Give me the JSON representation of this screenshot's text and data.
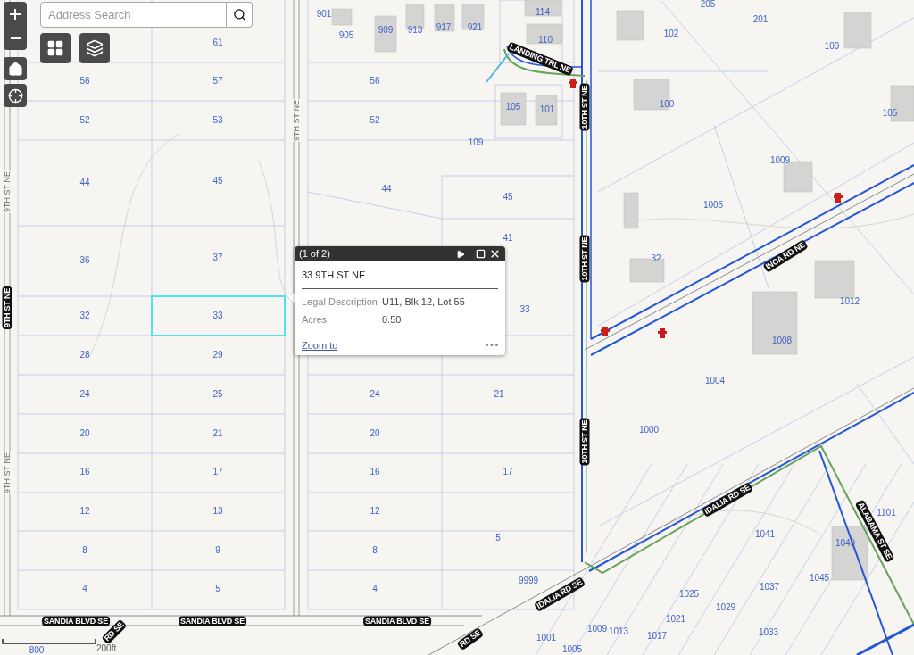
{
  "search": {
    "placeholder": "Address Search"
  },
  "map": {
    "parcel_labels": [
      "61",
      "56",
      "57",
      "52",
      "53",
      "44",
      "45",
      "36",
      "37",
      "32",
      "33",
      "28",
      "29",
      "24",
      "25",
      "20",
      "21",
      "16",
      "17",
      "12",
      "13",
      "8",
      "9",
      "4",
      "5",
      "901",
      "905",
      "909",
      "913",
      "917",
      "921",
      "56",
      "52",
      "109",
      "44",
      "45",
      "41",
      "33",
      "24",
      "21",
      "20",
      "16",
      "17",
      "12",
      "5",
      "8",
      "4",
      "9999",
      "114",
      "110",
      "105",
      "101",
      "205",
      "201",
      "102",
      "109",
      "100",
      "105",
      "1009",
      "1005",
      "32",
      "1012",
      "1008",
      "1004",
      "1000",
      "1101",
      "1041",
      "1049",
      "1045",
      "1037",
      "1025",
      "1029",
      "1033",
      "1021",
      "1017",
      "1009",
      "1013",
      "1001",
      "1005",
      "800"
    ],
    "street_labels": [
      {
        "text": "9TH ST NE",
        "kind": "minor"
      },
      {
        "text": "9TH ST NE",
        "kind": "minor"
      },
      {
        "text": "9TH ST NE",
        "kind": "major"
      },
      {
        "text": "9TH ST NE",
        "kind": "minor"
      },
      {
        "text": "LANDING TRL NE",
        "kind": "major"
      },
      {
        "text": "10TH ST NE",
        "kind": "major"
      },
      {
        "text": "10TH ST NE",
        "kind": "major"
      },
      {
        "text": "10TH ST NE",
        "kind": "major"
      },
      {
        "text": "INCA RD NE",
        "kind": "major"
      },
      {
        "text": "IDALIA RD SE",
        "kind": "major"
      },
      {
        "text": "IDALIA RD SE",
        "kind": "major"
      },
      {
        "text": "ALABAMA ST SE",
        "kind": "major"
      },
      {
        "text": "SANDIA BLVD SE",
        "kind": "major"
      },
      {
        "text": "SANDIA BLVD SE",
        "kind": "major"
      },
      {
        "text": "SANDIA BLVD SE",
        "kind": "major"
      },
      {
        "text": "RD SE",
        "kind": "major"
      },
      {
        "text": "RD SE",
        "kind": "major"
      }
    ],
    "selected_parcel": {
      "selected": true
    },
    "scale": {
      "label": "200ft"
    }
  },
  "popup": {
    "counter": "(1 of 2)",
    "title": "33 9TH ST NE",
    "fields": [
      {
        "label": "Legal Description",
        "value": "U11, Blk 12, Lot 55"
      },
      {
        "label": "Acres",
        "value": "0.50"
      }
    ],
    "link": "Zoom to"
  }
}
